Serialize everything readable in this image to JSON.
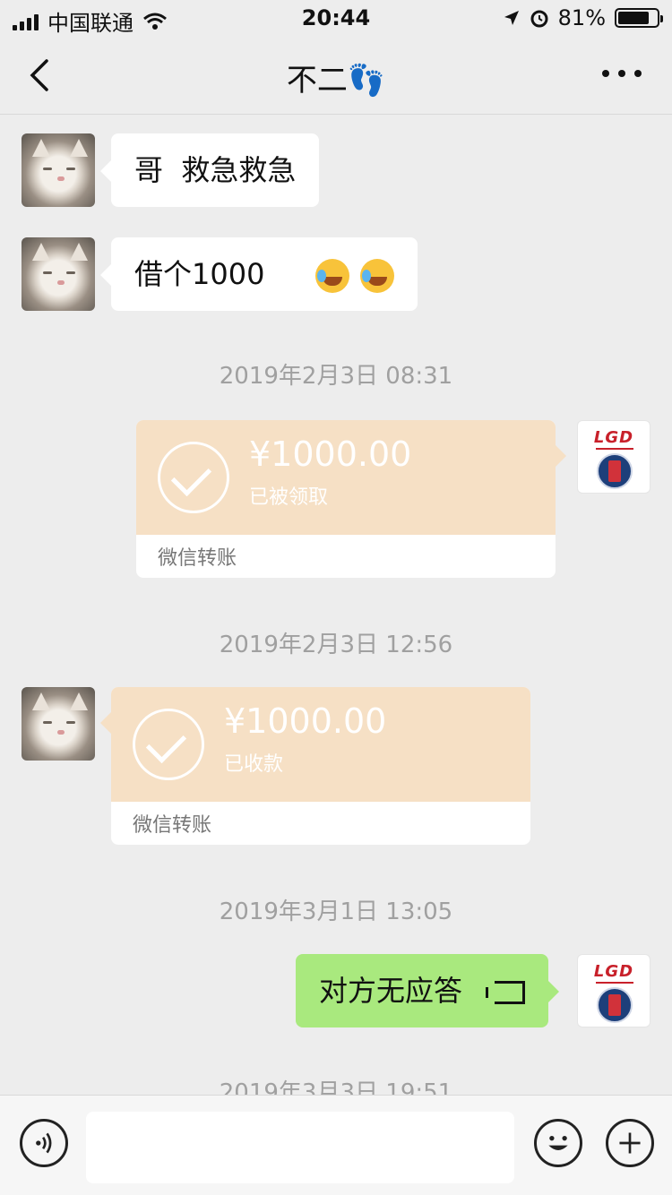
{
  "status_bar": {
    "carrier": "中国联通",
    "time": "20:44",
    "battery": "81%",
    "battery_level": 0.81,
    "icons": [
      "signal-icon",
      "wifi-icon",
      "location-icon",
      "alarm-icon",
      "battery-icon"
    ]
  },
  "nav": {
    "title": "不二👣",
    "back_icon": "chevron-left-icon",
    "more_icon": "more-dots-icon"
  },
  "messages": [
    {
      "type": "text",
      "side": "left",
      "text": "哥  救急救急"
    },
    {
      "type": "text",
      "side": "left",
      "text": "借个1000"
    },
    {
      "type": "time",
      "text": "2019年2月3日 08:31"
    },
    {
      "type": "transfer",
      "side": "right",
      "amount": "¥1000.00",
      "status": "已被领取",
      "footer": "微信转账"
    },
    {
      "type": "time",
      "text": "2019年2月3日 12:56"
    },
    {
      "type": "transfer",
      "side": "left",
      "amount": "¥1000.00",
      "status": "已收款",
      "footer": "微信转账"
    },
    {
      "type": "time",
      "text": "2019年3月1日 13:05"
    },
    {
      "type": "call",
      "side": "right",
      "text": "对方无应答"
    },
    {
      "type": "time",
      "text": "2019年3月3日 19:51"
    }
  ],
  "avatar_me_text": "LGD",
  "input_bar": {
    "voice_icon": "voice-icon",
    "emoji_icon": "emoji-icon",
    "plus_icon": "plus-icon"
  },
  "colors": {
    "background": "#ededed",
    "transfer": "#f6e0c5",
    "green_bubble": "#a9e97e"
  }
}
